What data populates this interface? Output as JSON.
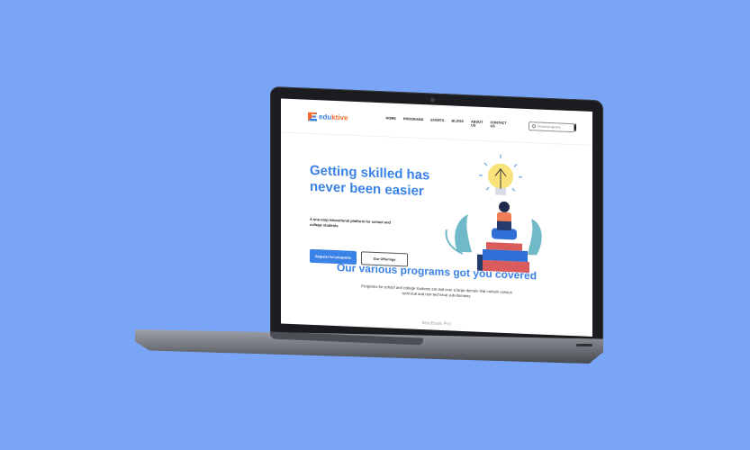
{
  "brand": {
    "logo_prefix": "edu",
    "logo_suffix": "ktive"
  },
  "nav": {
    "items": [
      "HOME",
      "PROGRAMS",
      "EVENTS",
      "BLOGS",
      "ABOUT US",
      "CONTACT US"
    ]
  },
  "search": {
    "placeholder": "Search programs"
  },
  "hero": {
    "title": "Getting skilled has never been easier",
    "subtitle": "A one-stop educational platform for school and college students",
    "primary_button": "Register for programs",
    "secondary_button": "Our Offerings"
  },
  "programs": {
    "title": "Our various programs got you covered",
    "description": "Programs for school and college students are laid over a large domain that contain various technical and non-technical sub-domains."
  },
  "device": {
    "label": "MacBook Pro"
  },
  "colors": {
    "background": "#7aa5f7",
    "accent": "#3b82e6",
    "brand_orange": "#f26b2a"
  },
  "icons": {
    "logo": "eduktive-logo-icon",
    "search": "search-icon",
    "user": "user-icon",
    "lightbulb": "lightbulb-icon"
  }
}
